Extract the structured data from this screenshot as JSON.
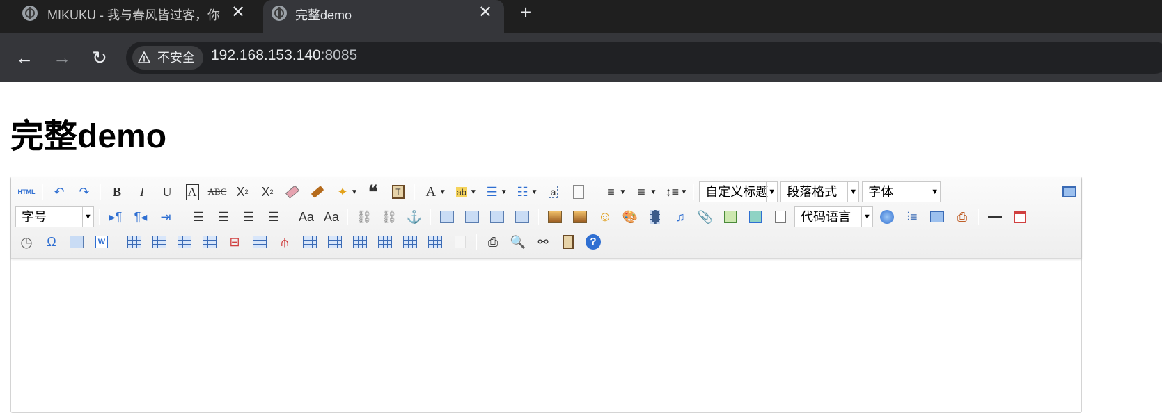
{
  "browser": {
    "tabs": [
      {
        "title": "MIKUKU - 我与春风皆过客，你"
      },
      {
        "title": "完整demo"
      }
    ],
    "new_tab_symbol": "+",
    "security_label": "不安全",
    "url_host": "192.168.153.140",
    "url_port": ":8085"
  },
  "page": {
    "heading": "完整demo"
  },
  "editor": {
    "dropdowns": {
      "custom_heading": "自定义标题",
      "paragraph_format": "段落格式",
      "font_family": "字体",
      "font_size": "字号",
      "code_language": "代码语言"
    },
    "icons_row1": [
      "html-source-icon",
      "undo-icon",
      "redo-icon",
      "bold-icon",
      "italic-icon",
      "underline-icon",
      "font-border-icon",
      "strikethrough-icon",
      "superscript-icon",
      "subscript-icon",
      "eraser-icon",
      "format-brush-icon",
      "auto-format-icon",
      "blockquote-icon",
      "paste-plain-icon",
      "font-color-icon",
      "background-color-icon",
      "ordered-list-icon",
      "unordered-list-icon",
      "select-all-icon",
      "clear-doc-icon",
      "row-spacing-top-icon",
      "row-spacing-bottom-icon",
      "line-height-icon",
      "fullscreen-icon"
    ],
    "accent_color": "#2f6fd2"
  }
}
